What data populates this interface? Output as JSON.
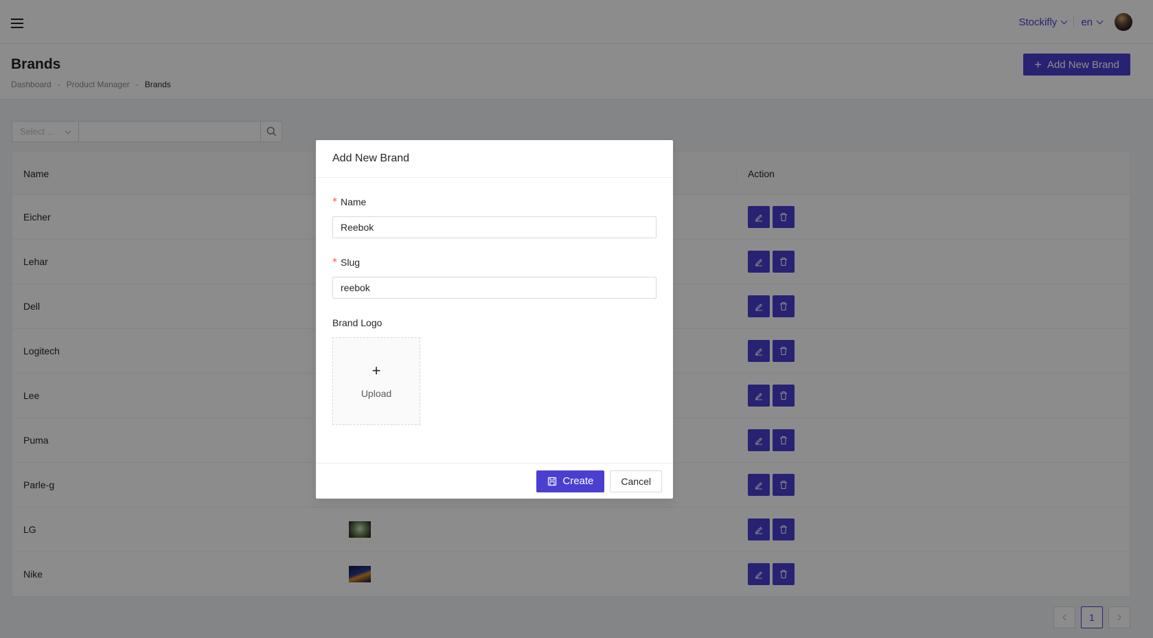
{
  "header": {
    "org": "Stockifly",
    "lang": "en"
  },
  "page": {
    "title": "Brands",
    "breadcrumb": [
      "Dashboard",
      "Product Manager",
      "Brands"
    ],
    "add_button": "Add New Brand"
  },
  "filter": {
    "select_placeholder": "Select ..."
  },
  "table": {
    "columns": [
      "Name",
      "Action"
    ],
    "rows": [
      {
        "name": "Eicher"
      },
      {
        "name": "Lehar"
      },
      {
        "name": "Dell"
      },
      {
        "name": "Logitech"
      },
      {
        "name": "Lee"
      },
      {
        "name": "Puma"
      },
      {
        "name": "Parle-g"
      },
      {
        "name": "LG"
      },
      {
        "name": "Nike"
      }
    ]
  },
  "pagination": {
    "current": "1"
  },
  "modal": {
    "title": "Add New Brand",
    "name_label": "Name",
    "name_value": "Reebok",
    "slug_label": "Slug",
    "slug_value": "reebok",
    "logo_label": "Brand Logo",
    "upload_text": "Upload",
    "upload_plus": "+",
    "create_label": "Create",
    "cancel_label": "Cancel"
  },
  "colors": {
    "primary": "#4a3fd0",
    "required": "#ff4d4f"
  }
}
